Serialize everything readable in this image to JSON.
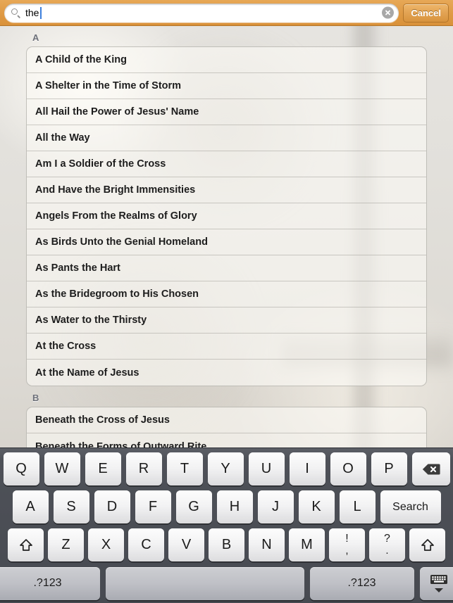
{
  "search": {
    "value": "the",
    "icon": "search-icon",
    "clear_icon": "clear-circle-icon",
    "cancel_label": "Cancel"
  },
  "list": {
    "sections": [
      {
        "header": "A",
        "items": [
          "A Child of the King",
          "A Shelter in the Time of Storm",
          "All Hail the Power of Jesus' Name",
          "All the Way",
          "Am I a Soldier of the Cross",
          "And Have the Bright Immensities",
          "Angels From the Realms of Glory",
          "As Birds Unto the Genial Homeland",
          "As Pants the Hart",
          "As the Bridegroom to His Chosen",
          "As Water to the Thirsty",
          "At the Cross",
          "At the Name of Jesus"
        ]
      },
      {
        "header": "B",
        "items": [
          "Beneath the Cross of Jesus",
          "Beneath the Forms of Outward Rite"
        ]
      }
    ]
  },
  "keyboard": {
    "row1": [
      "Q",
      "W",
      "E",
      "R",
      "T",
      "Y",
      "U",
      "I",
      "O",
      "P"
    ],
    "backspace_icon": "backspace-icon",
    "row2": [
      "A",
      "S",
      "D",
      "F",
      "G",
      "H",
      "J",
      "K",
      "L"
    ],
    "search_key_label": "Search",
    "row3": [
      "Z",
      "X",
      "C",
      "V",
      "B",
      "N",
      "M"
    ],
    "shift_icon": "shift-icon",
    "punct1_top": "!",
    "punct1_bottom": ",",
    "punct2_top": "?",
    "punct2_bottom": ".",
    "numeric_label": ".?123",
    "space_label": "",
    "hide_keyboard_icon": "hide-keyboard-icon"
  },
  "colors": {
    "searchbar_accent": "#e09c47",
    "caret": "#3c7fdc",
    "keyboard_bg": "#4e5158"
  }
}
